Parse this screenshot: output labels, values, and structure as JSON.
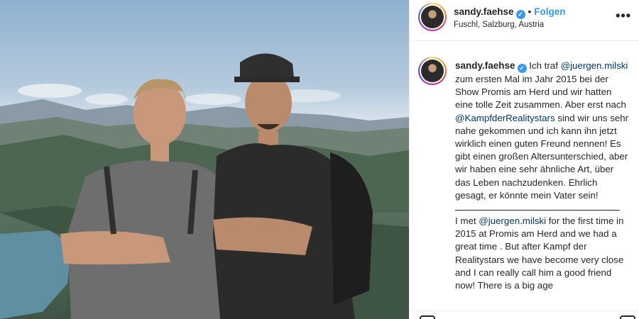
{
  "post": {
    "username": "sandy.faehse",
    "verified_mark": "✓",
    "separator": "•",
    "follow_label": "Folgen",
    "location": "Fuschl, Salzburg, Austria",
    "more_label": "•••"
  },
  "caption": {
    "username": "sandy.faehse",
    "de_part1": "Ich traf ",
    "de_mention1": "@juergen.milski",
    "de_part2": " zum ersten Mal im Jahr 2015 bei der Show Promis am Herd und wir hatten eine tolle Zeit zusammen. Aber erst nach ",
    "de_mention2": "@KampfderRealitystars",
    "de_part3": " sind wir uns sehr nahe gekommen und ich kann ihn jetzt wirklich einen guten Freund nennen! Es gibt einen großen Altersunterschied, aber wir haben eine sehr ähnliche Art, über das Leben nachzudenken. Ehrlich gesagt, er könnte mein Vater sein!",
    "en_part1": "I met ",
    "en_mention1": "@juergen.milski",
    "en_part2": " for the first time in 2015 at Promis am Herd and we had a great time . But after Kampf der Realitystars we have become very close and I can really call him a good friend now! There is a big age"
  },
  "icons": {
    "verified": "verified-badge-icon",
    "more": "more-options-icon",
    "like": "heart-icon",
    "comment": "comment-icon",
    "share": "paper-plane-icon",
    "save": "bookmark-icon"
  },
  "colors": {
    "link": "#00376b",
    "follow": "#3897f0",
    "text": "#262626"
  }
}
